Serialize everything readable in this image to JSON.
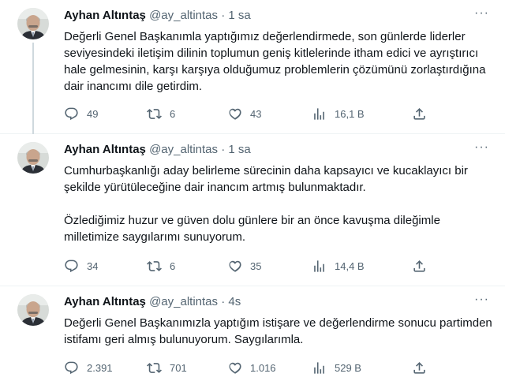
{
  "tweets": [
    {
      "name": "Ayhan Altıntaş",
      "handle": "@ay_altintas",
      "time": "· 1 sa",
      "text": [
        "Değerli Genel Başkanımla yaptığımız değerlendirmede, son günlerde liderler seviyesindeki iletişim dilinin toplumun geniş kitlelerinde itham edici ve ayrıştırıcı hale gelmesinin, karşı karşıya olduğumuz problemlerin çözümünü zorlaştırdığına dair inancımı dile getirdim."
      ],
      "stats": {
        "replies": "49",
        "retweets": "6",
        "likes": "43",
        "views": "16,1 B"
      }
    },
    {
      "name": "Ayhan Altıntaş",
      "handle": "@ay_altintas",
      "time": "· 1 sa",
      "text": [
        "Cumhurbaşkanlığı aday belirleme sürecinin daha kapsayıcı ve kucaklayıcı bir şekilde yürütüleceğine dair inancım artmış bulunmaktadır.",
        "Özlediğimiz huzur ve güven dolu günlere bir an önce kavuşma  dileğimle milletimize saygılarımı sunuyorum."
      ],
      "stats": {
        "replies": "34",
        "retweets": "6",
        "likes": "35",
        "views": "14,4 B"
      }
    },
    {
      "name": "Ayhan Altıntaş",
      "handle": "@ay_altintas",
      "time": "· 4s",
      "text": [
        "Değerli Genel Başkanımızla yaptığım istişare ve değerlendirme sonucu partimden istifamı geri almış bulunuyorum. Saygılarımla."
      ],
      "stats": {
        "replies": "2.391",
        "retweets": "701",
        "likes": "1.016",
        "views": "529 B"
      }
    }
  ],
  "icons": {
    "more": "more-horizontal-icon",
    "reply": "reply-icon",
    "retweet": "retweet-icon",
    "like": "heart-icon",
    "views": "views-chart-icon",
    "share": "share-icon"
  },
  "colors": {
    "text": "#0f1419",
    "secondary": "#536471",
    "divider": "#eff3f4",
    "thread": "#cfd9de"
  }
}
